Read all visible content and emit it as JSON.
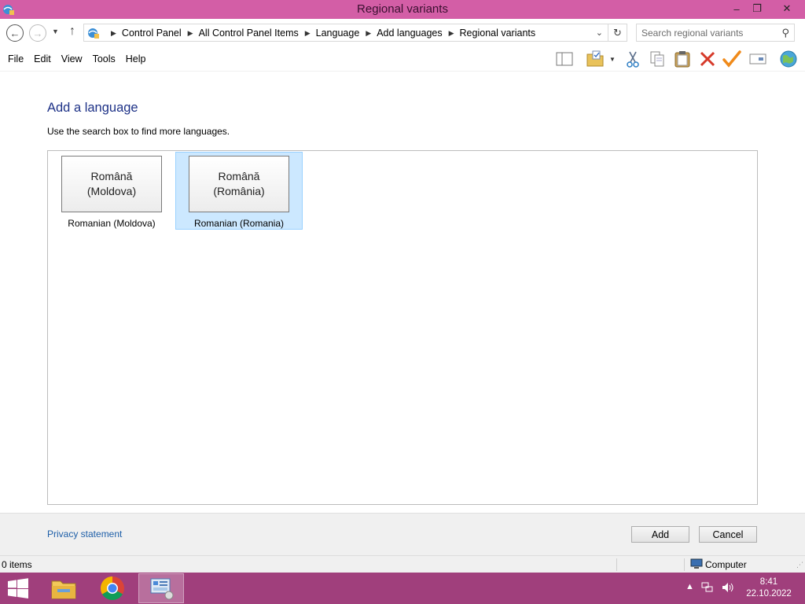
{
  "window": {
    "title": "Regional variants",
    "controls": {
      "minimize": "–",
      "restore": "❐",
      "close": "✕"
    }
  },
  "address": {
    "breadcrumbs": [
      "Control Panel",
      "All Control Panel Items",
      "Language",
      "Add languages",
      "Regional variants"
    ],
    "search_placeholder": "Search regional variants"
  },
  "menu": {
    "items": [
      "File",
      "Edit",
      "View",
      "Tools",
      "Help"
    ]
  },
  "toolbar": {
    "icons": [
      "layout-pane-icon",
      "folder-options-icon",
      "cut-icon",
      "copy-icon",
      "paste-icon",
      "delete-icon",
      "properties-checkmark-icon",
      "rename-icon",
      "globe-icon"
    ]
  },
  "main": {
    "heading": "Add a language",
    "instruction": "Use the search box to find more languages.",
    "languages": [
      {
        "native": "Română\n(Moldova)",
        "caption": "Romanian (Moldova)",
        "selected": false
      },
      {
        "native": "Română\n(România)",
        "caption": "Romanian (Romania)",
        "selected": true
      }
    ]
  },
  "footer": {
    "privacy_link": "Privacy statement",
    "add_label": "Add",
    "cancel_label": "Cancel"
  },
  "status": {
    "items_count": "0 items",
    "zone": "Computer"
  },
  "taskbar": {
    "time": "8:41",
    "date": "22.10.2022"
  },
  "colors": {
    "titlebar": "#d35ea6",
    "taskbar": "#a03f7c",
    "heading": "#1e3287",
    "selection": "#cce8ff",
    "link": "#1e5fa8"
  }
}
